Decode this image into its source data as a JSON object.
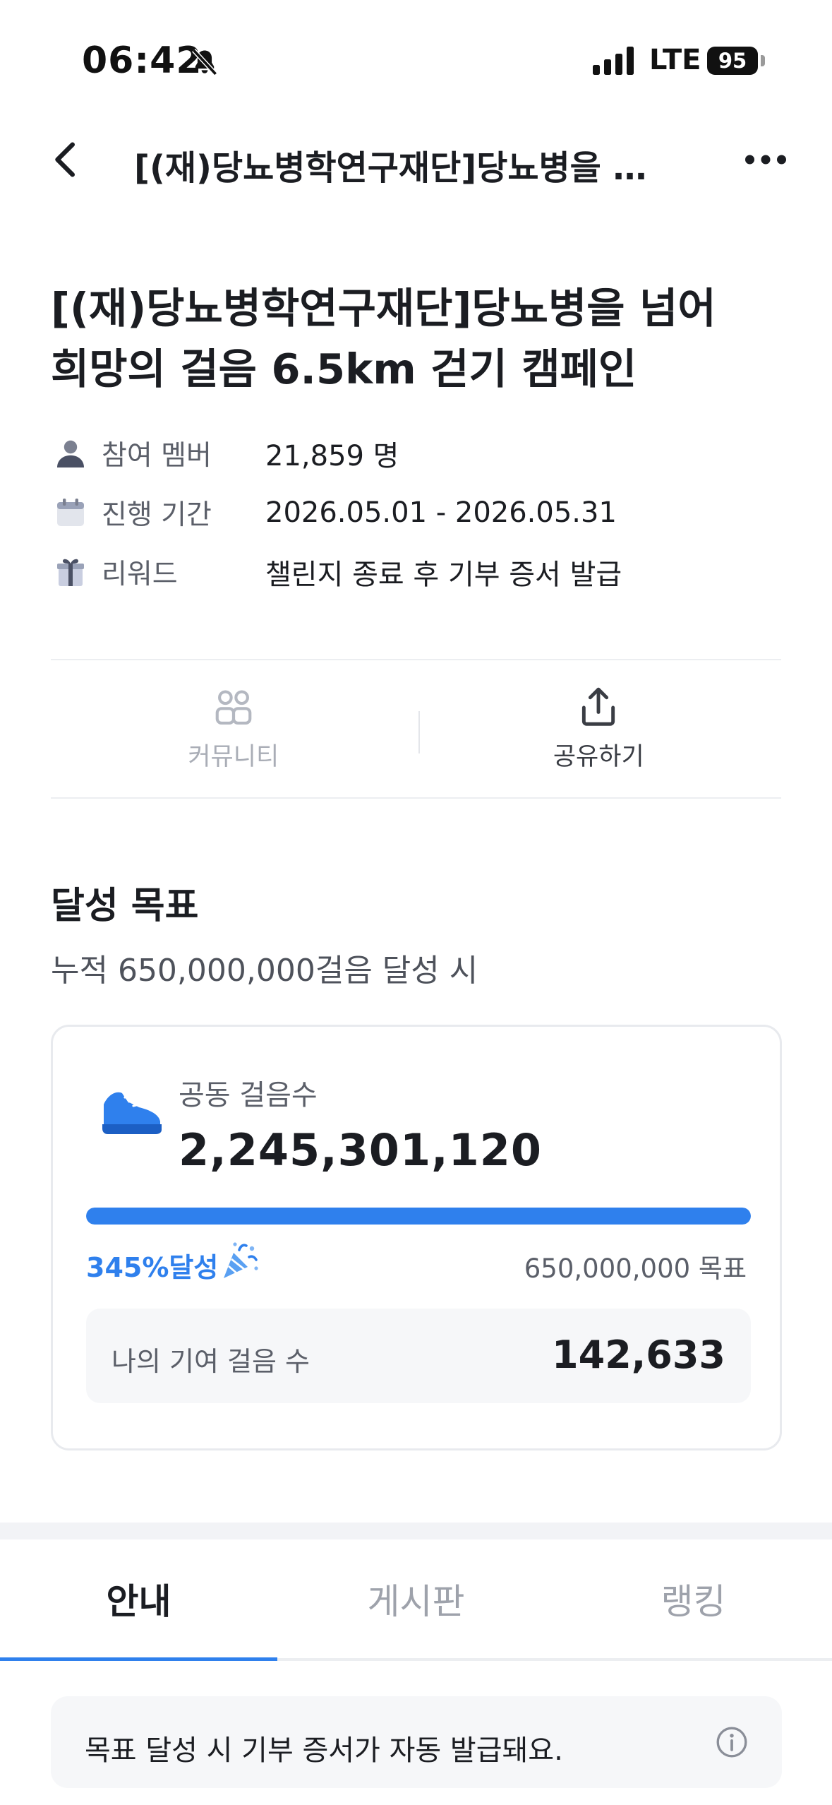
{
  "status_bar": {
    "time": "06:42",
    "network": "LTE",
    "battery": "95"
  },
  "header": {
    "title": "[(재)당뇨병학연구재단]당뇨병을 넘…"
  },
  "campaign": {
    "title_line1": "[(재)당뇨병학연구재단]당뇨병을 넘어",
    "title_line2": "희망의 걸음 6.5km 걷기 캠페인",
    "info": [
      {
        "label": "참여 멤버",
        "value": "21,859 명"
      },
      {
        "label": "진행 기간",
        "value": "2026.05.01 - 2026.05.31"
      },
      {
        "label": "리워드",
        "value": "챌린지 종료 후 기부 증서 발급"
      }
    ]
  },
  "actions": {
    "community_label": "커뮤니티",
    "share_label": "공유하기"
  },
  "goal": {
    "title": "달성 목표",
    "description": "누적 650,000,000걸음 달성 시",
    "card_label": "공동 걸음수",
    "total_steps": "2,245,301,120",
    "progress_percent": 100,
    "achieved_text": "345%달성",
    "target_text": "650,000,000 목표",
    "my_label": "나의 기여 걸음 수",
    "my_value": "142,633"
  },
  "tabs": [
    {
      "label": "안내",
      "active": true
    },
    {
      "label": "게시판",
      "active": false
    },
    {
      "label": "랭킹",
      "active": false
    }
  ],
  "notice": {
    "text": "목표 달성 시 기부 증서가 자동 발급돼요."
  },
  "colors": {
    "accent": "#2f80ed",
    "text_primary": "#1b1d22",
    "text_secondary": "#5b5f69",
    "icon_gray": "#7b8090"
  }
}
